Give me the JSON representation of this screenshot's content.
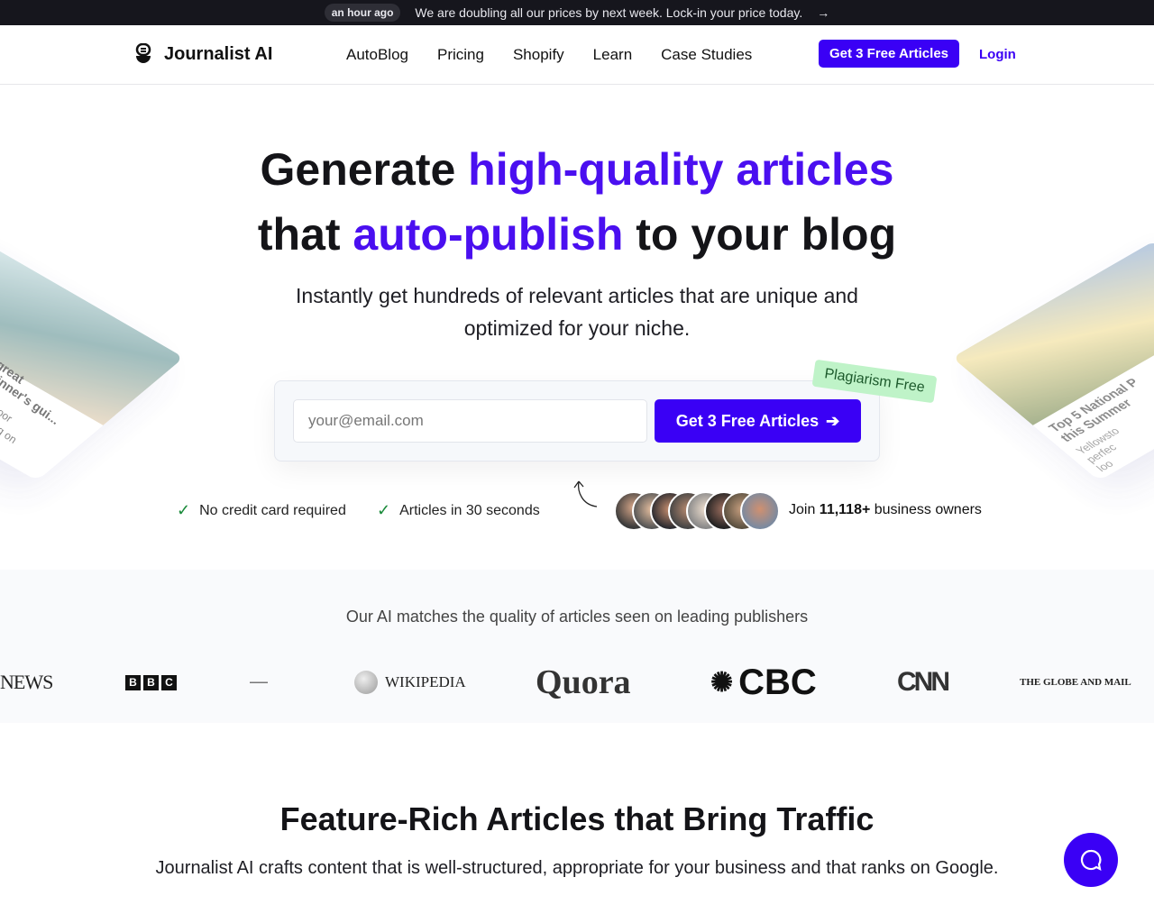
{
  "announcement": {
    "badge": "an hour ago",
    "text": "We are doubling all our prices by next week. Lock-in your price today.",
    "arrow": "→"
  },
  "nav": {
    "brand": "Journalist AI",
    "links": [
      "AutoBlog",
      "Pricing",
      "Shopify",
      "Learn",
      "Case Studies"
    ],
    "cta": "Get 3 Free Articles",
    "login": "Login"
  },
  "hero": {
    "title_1": "Generate ",
    "title_1_accent": "high-quality articles",
    "title_2_pre": "that ",
    "title_2_accent": "auto-publish",
    "title_2_post": " to your blog",
    "subtitle_1": "Instantly get hundreds of relevant articles that are unique and",
    "subtitle_2": "optimized for your niche.",
    "email_placeholder": "your@email.com",
    "cta": "Get 3 Free Articles",
    "badge": "Plagiarism Free",
    "perks": [
      "No credit card required",
      "Articles in 30 seconds"
    ],
    "join_pre": "Join ",
    "join_count": "11,118+",
    "join_post": " business owners"
  },
  "cards": {
    "left": {
      "title_1": "great",
      "title_2": "inner's gui...",
      "desc_1": "oor",
      "desc_2": "g on"
    },
    "right": {
      "title_1": "Top 5 National P",
      "title_2": "this Summer",
      "desc_1": "Yellowsto",
      "desc_2": "perfec",
      "desc_3": "loo"
    }
  },
  "publishers": {
    "title": "Our AI matches the quality of articles seen on leading publishers",
    "logos": [
      "NEWS",
      "BBC",
      "WIKIPEDIA",
      "Quora",
      "CBC",
      "CNN",
      "THE GLOBE AND MAIL"
    ]
  },
  "features": {
    "title": "Feature-Rich Articles that Bring Traffic",
    "subtitle": "Journalist AI crafts content that is well-structured, appropriate for your business and that ranks on Google."
  },
  "colors": {
    "accent": "#3a00f5",
    "heading_accent": "#4a0ff0",
    "badge_green": "#bff3c8",
    "topbar": "#16161d"
  },
  "icons": {
    "chat": "chat-bubble-icon",
    "check": "check-icon",
    "arrow": "arrow-right-icon"
  }
}
